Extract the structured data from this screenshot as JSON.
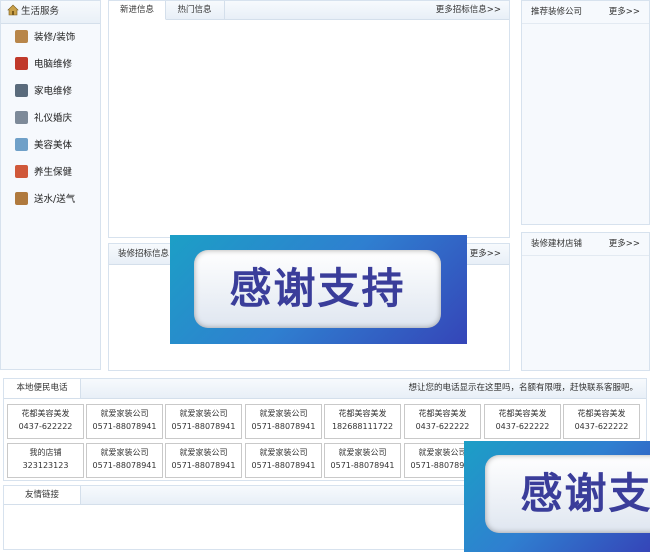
{
  "left_menu": {
    "title": "生活服务",
    "items": [
      {
        "label": "装修/装饰",
        "icon": "decoration-icon"
      },
      {
        "label": "电脑维修",
        "icon": "person-icon"
      },
      {
        "label": "家电维修",
        "icon": "appliance-icon"
      },
      {
        "label": "礼仪婚庆",
        "icon": "wedding-icon"
      },
      {
        "label": "美容美体",
        "icon": "beauty-icon"
      },
      {
        "label": "养生保健",
        "icon": "health-icon"
      },
      {
        "label": "送水/送气",
        "icon": "delivery-icon"
      }
    ]
  },
  "news": {
    "tabs": [
      "新进信息",
      "热门信息"
    ],
    "more": "更多招标信息>>"
  },
  "tender": {
    "title": "装修招标信息",
    "more": "更多>>"
  },
  "recommended": {
    "title": "推荐装修公司",
    "more": "更多>>"
  },
  "materials": {
    "title": "装修建材店铺",
    "more": "更多>>"
  },
  "phones": {
    "title": "本地便民电话",
    "notice": "想让您的电话显示在这里吗，名额有限哦，赶快联系客服吧。",
    "row1": [
      {
        "name": "花都美容美发",
        "phone": "0437-622222"
      },
      {
        "name": "就爱家装公司",
        "phone": "0571-88078941"
      },
      {
        "name": "就爱家装公司",
        "phone": "0571-88078941"
      },
      {
        "name": "就爱家装公司",
        "phone": "0571-88078941"
      },
      {
        "name": "花都美容美发",
        "phone": "182688111722"
      },
      {
        "name": "花都美容美发",
        "phone": "0437-622222"
      },
      {
        "name": "花都美容美发",
        "phone": "0437-622222"
      },
      {
        "name": "花都美容美发",
        "phone": "0437-622222"
      }
    ],
    "row2": [
      {
        "name": "我的店铺",
        "phone": "323123123"
      },
      {
        "name": "就爱家装公司",
        "phone": "0571-88078941"
      },
      {
        "name": "就爱家装公司",
        "phone": "0571-88078941"
      },
      {
        "name": "就爱家装公司",
        "phone": "0571-88078941"
      },
      {
        "name": "就爱家装公司",
        "phone": "0571-88078941"
      },
      {
        "name": "就爱家装公司",
        "phone": "0571-88078941"
      }
    ]
  },
  "links": {
    "title": "友情链接"
  },
  "banners": {
    "text": "感谢支持"
  },
  "colors": {
    "border": "#d7e2ee",
    "panel_bg": "#f6f9fd",
    "banner_text": "#3a3d9a"
  }
}
